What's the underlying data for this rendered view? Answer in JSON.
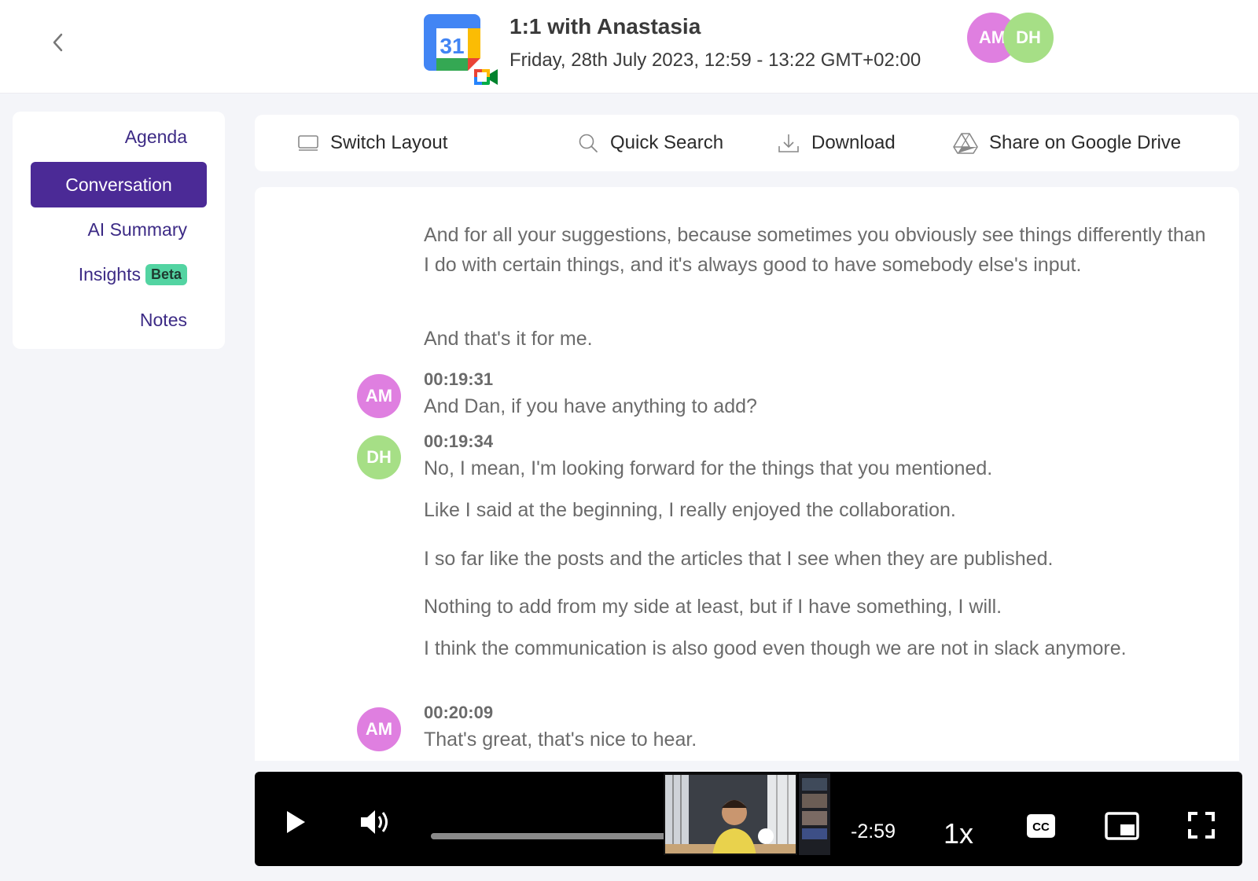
{
  "header": {
    "title": "1:1 with Anastasia",
    "datetime": "Friday, 28th July 2023, 12:59 - 13:22 GMT+02:00",
    "calendar_day": "31",
    "participants": [
      "AM",
      "DH"
    ]
  },
  "sidebar": {
    "items": [
      {
        "label": "Agenda"
      },
      {
        "label": "Conversation",
        "active": true
      },
      {
        "label": "AI Summary"
      },
      {
        "label": "Insights",
        "badge": "Beta"
      },
      {
        "label": "Notes"
      }
    ]
  },
  "toolbar": {
    "switch_layout": "Switch Layout",
    "quick_search": "Quick Search",
    "download": "Download",
    "share_drive": "Share on Google Drive"
  },
  "transcript": {
    "lead_lines": [
      "And for all your suggestions, because sometimes you obviously see things differently than I do with certain things, and it's always good to have somebody else's input.",
      "And that's it for me."
    ],
    "entries": [
      {
        "speaker": "AM",
        "time": "00:19:31",
        "lines": [
          "And Dan, if you have anything to add?"
        ]
      },
      {
        "speaker": "DH",
        "time": "00:19:34",
        "lines": [
          "No, I mean, I'm looking forward for the things that you mentioned.",
          "Like I said at the beginning, I really enjoyed the collaboration.",
          "I so far like the posts and the articles that I see when they are published.",
          "Nothing to add from my side at least, but if I have something, I will.",
          "I think the communication is also good even though we are not in slack anymore."
        ]
      },
      {
        "speaker": "AM",
        "time": "00:20:09",
        "lines": [
          "That's great, that's nice to hear."
        ]
      }
    ]
  },
  "player": {
    "time_remaining": "-2:59",
    "speed": "1x",
    "cc_label": "CC",
    "progress_fraction": 0.9
  },
  "colors": {
    "accent": "#4b2a96",
    "am_avatar": "#df7fe0",
    "dh_avatar": "#a6df86",
    "beta_badge": "#53d4a2"
  }
}
